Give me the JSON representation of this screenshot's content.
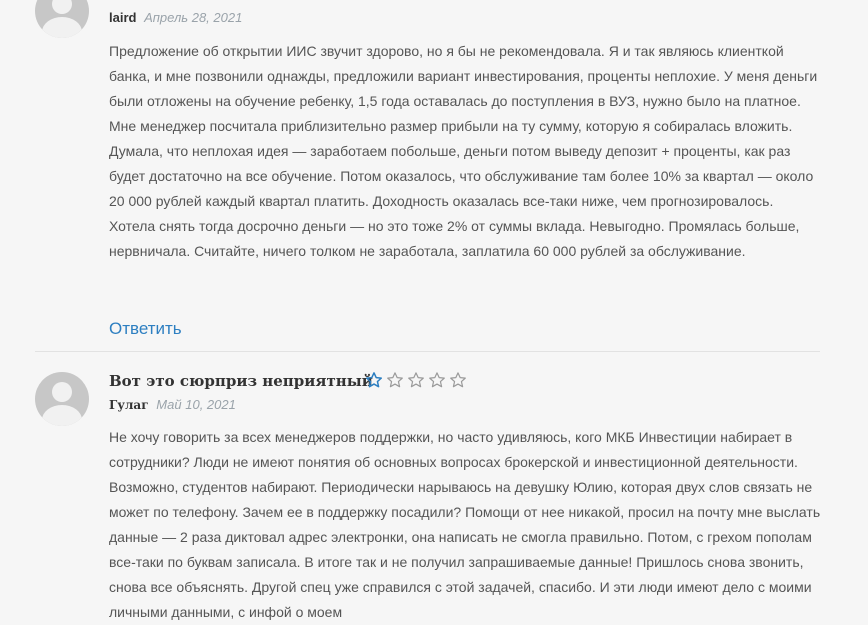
{
  "reviews": [
    {
      "title": "",
      "author": "laird",
      "date": "Апрель 28, 2021",
      "rating": null,
      "text": "Предложение об открытии ИИС звучит здорово, но я бы не рекомендовала. Я и так являюсь клиенткой банка, и мне позвонили однажды, предложили вариант инвестирования, проценты неплохие. У меня деньги были отложены на обучение ребенку, 1,5 года оставалась до поступления в ВУЗ, нужно было на платное. Мне менеджер посчитала приблизительно размер прибыли на ту сумму, которую я собиралась вложить. Думала, что неплохая идея — заработаем побольше, деньги потом выведу депозит + проценты, как раз будет достаточно на все обучение. Потом оказалось, что обслуживание там более 10% за квартал — около 20 000 рублей каждый квартал платить. Доходность оказалась все-таки ниже, чем прогнозировалось. Хотела снять тогда досрочно деньги — но это тоже 2% от суммы вклада. Невыгодно. Промялась больше, нервничала. Считайте, ничего толком не заработала, заплатила 60 000 рублей за обслуживание.",
      "reply_label": "Ответить"
    },
    {
      "title": "Вот это сюрприз неприятный",
      "author": "Гулаг",
      "date": "Май 10, 2021",
      "rating": 1,
      "rating_max": 5,
      "text": "Не хочу говорить за всех менеджеров поддержки, но часто удивляюсь, кого МКБ Инвестиции набирает в сотрудники? Люди не имеют понятия об основных вопросах брокерской и инвестиционной деятельности. Возможно, студентов набирают. Периодически нарываюсь на девушку Юлию, которая двух слов связать не может по телефону. Зачем ее в поддержку посадили? Помощи от нее никакой, просил на почту мне выслать данные — 2 раза диктовал адрес электронки, она написать не смогла правильно. Потом, с грехом пополам все-таки по буквам записала. В итоге так и не получил запрашиваемые данные! Пришлось снова звонить, снова все объяснять. Другой спец уже справился с этой задачей, спасибо. И эти люди имеют дело с моими личными данными, с инфой о моем"
    }
  ],
  "colors": {
    "background": "#f6f6f6",
    "text": "#555555",
    "heading": "#333333",
    "date": "#9aa3aa",
    "link": "#2d7fc1",
    "star": "#2d7fc1",
    "star_empty": "#9a9a9a",
    "divider": "#e2e2e2"
  },
  "icons": {
    "avatar": "default-user-avatar",
    "star_filled": "star-outline-blue",
    "star_empty": "star-outline-gray"
  }
}
